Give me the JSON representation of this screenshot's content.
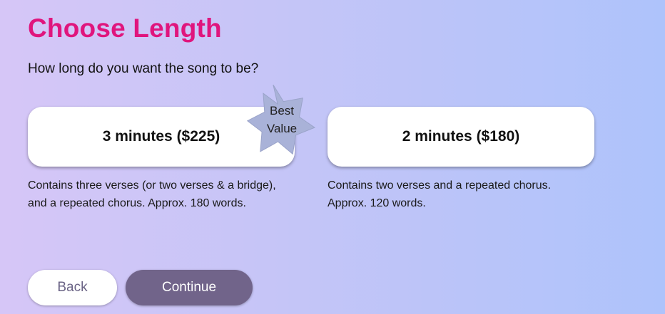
{
  "header": {
    "title": "Choose Length",
    "question": "How long do you want the song to be?"
  },
  "options": [
    {
      "label": "3 minutes ($225)",
      "description": "Contains three verses (or two verses & a bridge), and a repeated chorus. Approx. 180 words."
    },
    {
      "label": "2 minutes ($180)",
      "description": "Contains two verses and a repeated chorus. Approx. 120 words."
    }
  ],
  "badge": {
    "text": "Best\nValue",
    "color": "#a9b2d8"
  },
  "buttons": {
    "back": "Back",
    "continue": "Continue"
  },
  "colors": {
    "title": "#e0157d",
    "continue_bg": "#71648a",
    "back_text": "#6a6385"
  }
}
